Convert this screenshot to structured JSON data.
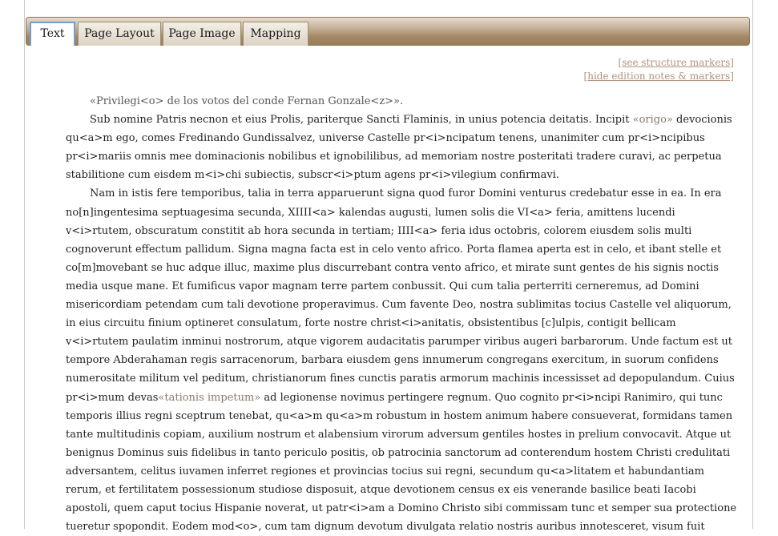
{
  "tabs": [
    {
      "label": "Text",
      "active": true
    },
    {
      "label": "Page Layout",
      "active": false
    },
    {
      "label": "Page Image",
      "active": false
    },
    {
      "label": "Mapping",
      "active": false
    }
  ],
  "links": {
    "structure": "[see structure markers]",
    "notes": "[hide edition notes & markers]"
  },
  "doc": {
    "title": "«Privilegi<o> de los votos del conde Fernan Gonzale<z>».",
    "p1_a": "Sub nomine Patris necnon et eius Prolis, pariterque Sancti Flaminis, in unius potencia deitatis. Incipit ",
    "p1_note": "«origo»",
    "p1_b": " devocionis qu<a>m ego, comes Fredinando Gundissalvez, universe Castelle pr<i>ncipatum tenens, unanimiter cum pr<i>ncipibus pr<i>mariis omnis mee dominacionis nobilibus et ignobililibus, ad memoriam nostre posteritati tradere curavi, ac perpetua stabilitione cum eisdem m<i>chi subiectis, subscr<i>ptum agens pr<i>vilegium confirmavi.",
    "p2_a": "Nam in istis fere temporibus, talia in terra apparuerunt signa quod furor Domini venturus credebatur esse in ea. In era no[n]ingentesima septuagesima secunda, XIIII<a> kalendas augusti, lumen solis die VI<a> feria, amittens lucendi v<i>rtutem, obscuratum constitit ab hora secunda in tertiam; IIII<a> feria idus octobris, colorem eiusdem solis multi cognoverunt effectum pallidum. Signa magna facta est in celo vento africo. Porta flamea aperta est in celo, et ibant stelle et co[m]movebant se huc adque illuc, maxime plus discurrebant contra vento africo, et mirate sunt gentes de his signis noctis media usque mane. Et fumificus vapor magnam terre partem conbussit. Qui cum talia perterriti cerneremus, ad Domini misericordiam petendam cum tali devotione properavimus. Cum favente Deo, nostra sublimitas tocius Castelle vel aliquorum, in eius circuitu finium optineret consulatum, forte nostre christ<i>anitatis, obsistentibus [c]ulpis, contigit bellicam v<i>rtutem paulatim inminui nostrorum, atque vigorem audacitatis parumper viribus augeri barbarorum. Unde factum est ut tempore Abderahaman regis sarracenorum, barbara eiusdem gens innumerum congregans exercitum, in suorum confidens numerositate militum vel peditum, christianorum fines cunctis paratis armorum machinis incessisset ad depopulandum. Cuius pr<i>mum devas",
    "p2_note": "«tationis impetum»",
    "p2_b": " ad legionense novimus pertingere regnum. Quo cognito pr<i>ncipi Ranimiro, qui tunc temporis illius regni sceptrum tenebat, qu<a>m qu<a>m robustum in hostem animum habere consueverat, formidans tamen tante multitudinis copiam, auxilium nostrum et alabensium virorum adversum gentiles hostes in prelium convocavit. Atque ut benignus Dominus suis fidelibus in tanto periculo positis, ob patrocinia sanctorum ad conterendum hostem Christi credulitati adversantem, celitus iuvamen inferret regiones et provincias tocius sui regni, secundum qu<a>litatem et habundantiam rerum, et fertilitatem possessionum studiose disposuit, atque devotionem census ex eis venerande basilice beati Iacobi apostoli, quem caput tocius Hispanie noverat, ut patr<i>am a Domino Christo sibi commissam tunc et semper sua protectione tueretur spopondit. Eodem mod<o>, cum tam dignum devotum divulgata relatio nostris auribus innotesceret, visum fuit"
  }
}
